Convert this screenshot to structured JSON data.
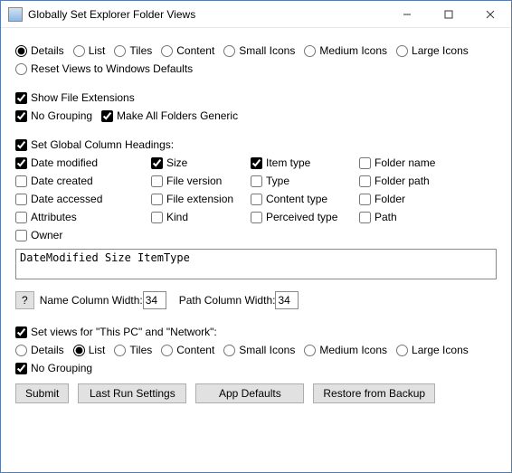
{
  "title": "Globally Set Explorer Folder Views",
  "viewModes": {
    "details": "Details",
    "list": "List",
    "tiles": "Tiles",
    "content": "Content",
    "smallIcons": "Small Icons",
    "mediumIcons": "Medium Icons",
    "largeIcons": "Large Icons"
  },
  "resetViews": "Reset Views to Windows Defaults",
  "showFileExt": "Show File Extensions",
  "noGrouping": "No Grouping",
  "makeGeneric": "Make All Folders Generic",
  "setColumns": "Set Global Column Headings:",
  "columns": {
    "dateModified": "Date modified",
    "size": "Size",
    "itemType": "Item type",
    "folderName": "Folder name",
    "dateCreated": "Date created",
    "fileVersion": "File version",
    "type": "Type",
    "folderPath": "Folder path",
    "dateAccessed": "Date accessed",
    "fileExtension": "File extension",
    "contentType": "Content type",
    "folder": "Folder",
    "attributes": "Attributes",
    "kind": "Kind",
    "perceivedType": "Perceived type",
    "path": "Path",
    "owner": "Owner"
  },
  "columnText": "DateModified Size ItemType",
  "helpBtn": "?",
  "nameColLabel": "Name Column Width:",
  "nameColVal": "34",
  "pathColLabel": "Path Column Width:",
  "pathColVal": "34",
  "setViewsThisPC": "Set views for \"This PC\" and \"Network\":",
  "noGrouping2": "No Grouping",
  "buttons": {
    "submit": "Submit",
    "lastRun": "Last Run Settings",
    "appDefaults": "App Defaults",
    "restore": "Restore from Backup"
  }
}
